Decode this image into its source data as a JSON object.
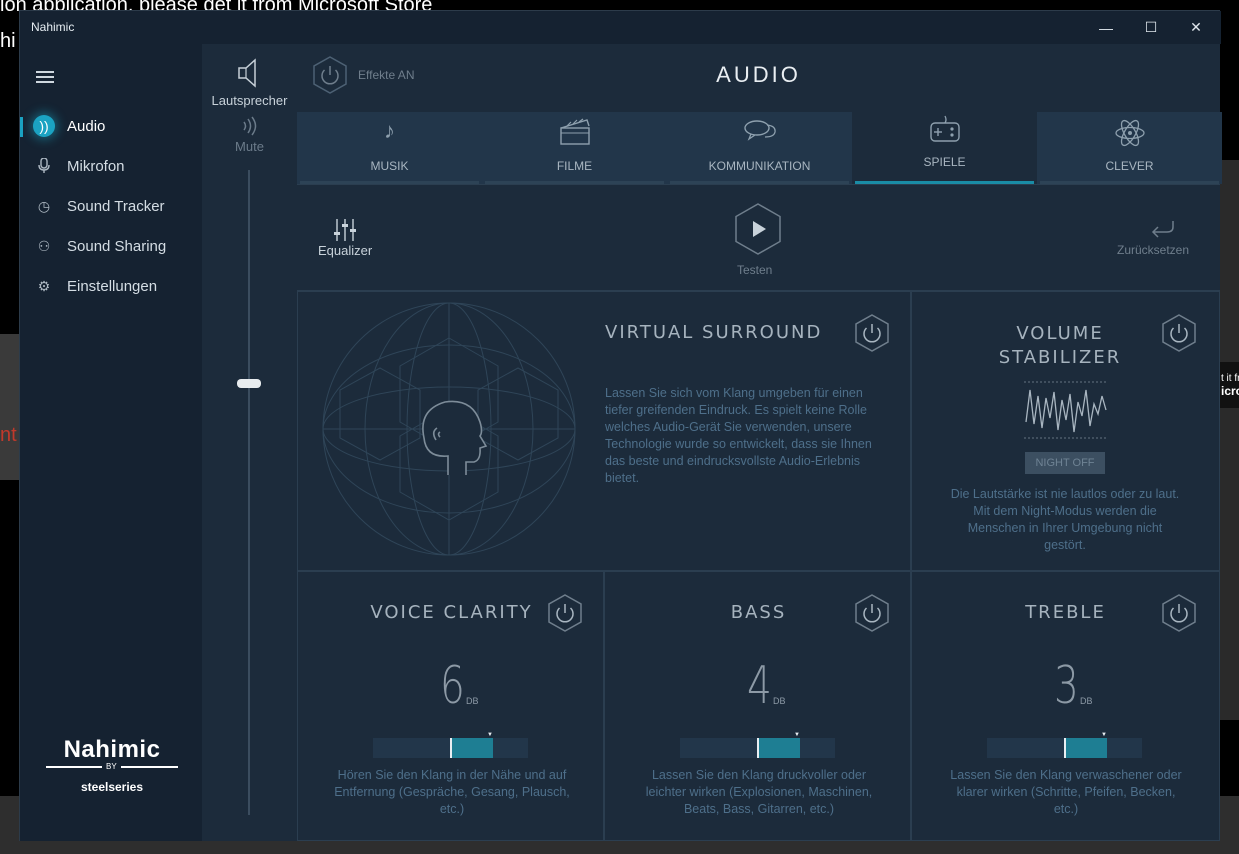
{
  "background": {
    "line1": "ion application, please get it from Microsoft Store",
    "line2": "hi",
    "red_text": "nt",
    "right_text": [
      "t it fr",
      "icro"
    ]
  },
  "window": {
    "title": "Nahimic",
    "minimize": "—",
    "maximize": "☐",
    "close": "✕"
  },
  "sidebar": {
    "items": [
      {
        "label": "Audio",
        "icon": "audio-waves-icon",
        "glyph": "))"
      },
      {
        "label": "Mikrofon",
        "icon": "microphone-icon",
        "glyph": "🎙"
      },
      {
        "label": "Sound Tracker",
        "icon": "compass-icon",
        "glyph": "◷"
      },
      {
        "label": "Sound Sharing",
        "icon": "sharing-icon",
        "glyph": "⚇"
      },
      {
        "label": "Einstellungen",
        "icon": "gear-icon",
        "glyph": "⚙"
      }
    ],
    "brand": {
      "name": "Nahimic",
      "by": "BY",
      "partner": "steelseries"
    }
  },
  "volume": {
    "device_label": "Lautsprecher",
    "mute_label": "Mute",
    "level_fraction": 0.68
  },
  "header": {
    "effects_label": "Effekte AN",
    "title": "AUDIO"
  },
  "tabs": [
    {
      "label": "MUSIK",
      "icon": "music-note-icon",
      "glyph": "♪",
      "active": false
    },
    {
      "label": "FILME",
      "icon": "clapperboard-icon",
      "glyph": "🎬",
      "active": false
    },
    {
      "label": "KOMMUNIKATION",
      "icon": "chat-bubbles-icon",
      "glyph": "💬",
      "active": false
    },
    {
      "label": "SPIELE",
      "icon": "gamepad-icon",
      "glyph": "🎮",
      "active": true
    },
    {
      "label": "CLEVER",
      "icon": "atom-icon",
      "glyph": "⚛",
      "active": false
    }
  ],
  "tools": {
    "equalizer_label": "Equalizer",
    "test_label": "Testen",
    "reset_label": "Zurücksetzen"
  },
  "virtual_surround": {
    "title": "VIRTUAL SURROUND",
    "description": "Lassen Sie sich vom Klang umgeben für einen tiefer greifenden Eindruck. Es spielt keine Rolle welches Audio-Gerät Sie verwenden, unsere Technologie wurde so entwickelt, dass sie Ihnen das beste und eindrucksvollste Audio-Erlebnis bietet."
  },
  "volume_stabilizer": {
    "title_line1": "VOLUME",
    "title_line2": "STABILIZER",
    "night_label": "NIGHT OFF",
    "description": "Die Lautstärke ist nie lautlos oder zu laut. Mit dem Night-Modus werden die Menschen in Ihrer Umgebung nicht gestört."
  },
  "voice_clarity": {
    "title": "VOICE CLARITY",
    "value": "6",
    "unit": "DB",
    "level_fraction": 0.5,
    "description": "Hören Sie den Klang in der Nähe und auf Entfernung (Gespräche, Gesang, Plausch, etc.)"
  },
  "bass": {
    "title": "BASS",
    "value": "4",
    "unit": "DB",
    "level_fraction": 0.5,
    "description": "Lassen Sie den Klang druckvoller oder leichter wirken (Explosionen, Maschinen, Beats, Bass, Gitarren, etc.)"
  },
  "treble": {
    "title": "TREBLE",
    "value": "3",
    "unit": "DB",
    "level_fraction": 0.5,
    "description": "Lassen Sie den Klang verwaschener oder klarer wirken (Schritte, Pfeifen, Becken, etc.)"
  }
}
